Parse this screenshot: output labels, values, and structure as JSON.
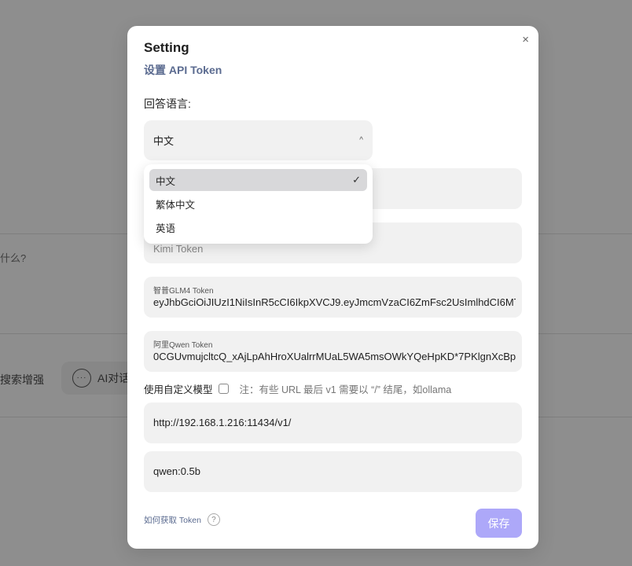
{
  "background": {
    "question_fragment": "什么?",
    "search_label": "搜索增强",
    "ai_label": "AI对话",
    "chat_icon_dots": "···"
  },
  "modal": {
    "close_symbol": "×",
    "title": "Setting",
    "subtitle": "设置 API Token",
    "language_label": "回答语言:",
    "language_select": {
      "value": "中文",
      "chevron": "^",
      "options": [
        {
          "label": "中文",
          "selected": true
        },
        {
          "label": "繁体中文",
          "selected": false
        },
        {
          "label": "英语",
          "selected": false
        }
      ],
      "check_symbol": "✓"
    },
    "kimi_field": {
      "placeholder": "Kimi Token"
    },
    "glm_field": {
      "label": "智普GLM4 Token",
      "value": "eyJhbGciOiJIUzI1NiIsInR5cCI6IkpXVCJ9.eyJmcmVzaCI6ZmFsc2UsImlhdCI6MT"
    },
    "qwen_field": {
      "label": "阿里Qwen Token",
      "value": "0CGUvmujcltcQ_xAjLpAhHroXUalrrMUaL5WA5msOWkYQeHpKD*7PKlgnXcBp"
    },
    "custom_model": {
      "label": "使用自定义模型",
      "checked": false,
      "note": "注：有些 URL 最后 v1 需要以 “/” 结尾，如ollama"
    },
    "url_field": {
      "value": "http://192.168.1.216:11434/v1/"
    },
    "model_field": {
      "value": "qwen:0.5b"
    },
    "help_link": "如何获取 Token",
    "help_icon": "?",
    "save_label": "保存",
    "colors": {
      "accent": "#ada8f9",
      "subtitle": "#5b6b90",
      "input_bg": "#f1f1f1",
      "selected_option_bg": "#d8d8da",
      "overlay": "#8e8e8e"
    }
  }
}
